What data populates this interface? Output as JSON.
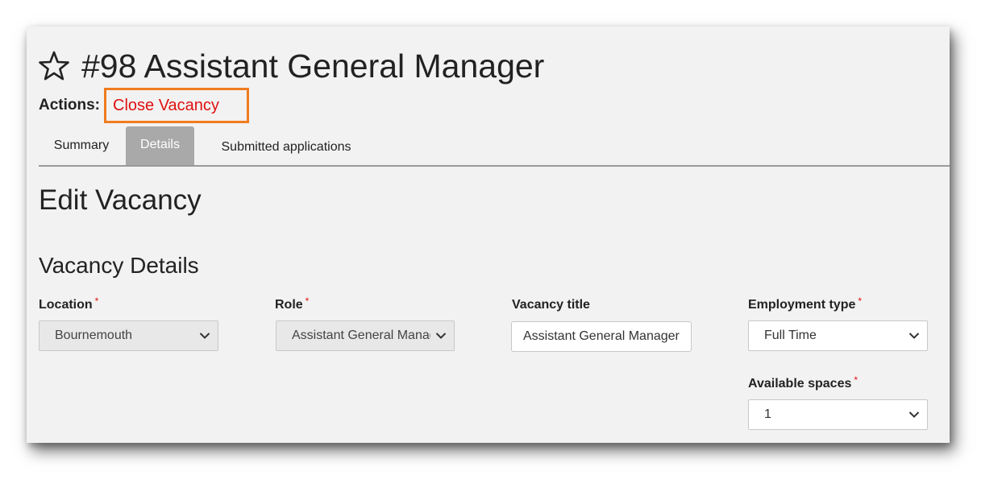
{
  "header": {
    "title": "#98 Assistant General Manager",
    "favorite_icon": "star-icon"
  },
  "actions": {
    "label": "Actions:",
    "close_vacancy": "Close Vacancy",
    "highlight_color": "#f07c1e",
    "link_color": "#e01010"
  },
  "tabs": [
    {
      "label": "Summary",
      "active": false
    },
    {
      "label": "Details",
      "active": true
    },
    {
      "label": "Submitted applications",
      "active": false
    }
  ],
  "page": {
    "heading": "Edit Vacancy",
    "section": "Vacancy Details"
  },
  "form": {
    "required_marker": "*",
    "location": {
      "label": "Location",
      "value": "Bournemouth",
      "disabled": true
    },
    "role": {
      "label": "Role",
      "value": "Assistant General Manager",
      "disabled": true
    },
    "vacancy_title": {
      "label": "Vacancy title",
      "value": "Assistant General Manager"
    },
    "employment_type": {
      "label": "Employment type",
      "value": "Full Time"
    },
    "available_spaces": {
      "label": "Available spaces",
      "value": "1"
    }
  }
}
